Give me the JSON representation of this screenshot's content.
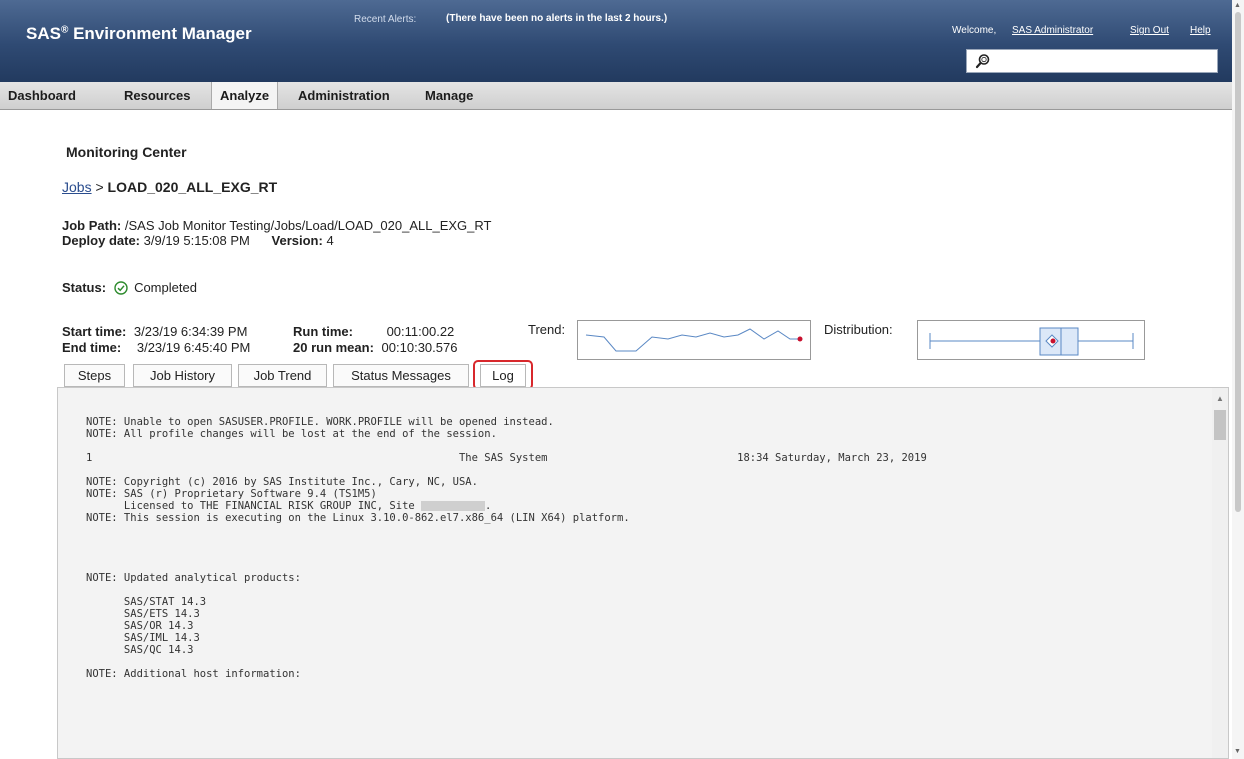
{
  "header": {
    "app_title": "SAS",
    "app_title_suffix": "Environment Manager",
    "registered": "®",
    "recent_alerts_label": "Recent Alerts:",
    "alerts_text": "(There have been no alerts in the last 2 hours.)",
    "welcome": "Welcome,",
    "user_link": "SAS Administrator",
    "sign_out": "Sign Out",
    "help": "Help",
    "search_placeholder": ""
  },
  "nav": {
    "items": [
      {
        "label": "Dashboard"
      },
      {
        "label": "Resources"
      },
      {
        "label": "Analyze"
      },
      {
        "label": "Administration"
      },
      {
        "label": "Manage"
      }
    ],
    "active": "Analyze"
  },
  "page": {
    "title": "Monitoring Center",
    "breadcrumb_link": "Jobs",
    "breadcrumb_sep": " > ",
    "breadcrumb_current": "LOAD_020_ALL_EXG_RT"
  },
  "job": {
    "path_label": "Job Path:",
    "path": "/SAS Job Monitor Testing/Jobs/Load/LOAD_020_ALL_EXG_RT",
    "deploy_label": "Deploy date:",
    "deploy_date": "3/9/19 5:15:08 PM",
    "version_label": "Version:",
    "version": "4",
    "status_label": "Status:",
    "status": "Completed",
    "start_label": "Start time:",
    "start_time": "3/23/19 6:34:39 PM",
    "end_label": "End time:",
    "end_time": "3/23/19 6:45:40 PM",
    "runtime_label": "Run time:",
    "runtime": "00:11:00.22",
    "mean_label": "20 run mean:",
    "mean": "00:10:30.576",
    "trend_label": "Trend:",
    "distribution_label": "Distribution:"
  },
  "tabs": [
    {
      "label": "Steps"
    },
    {
      "label": "Job History"
    },
    {
      "label": "Job Trend"
    },
    {
      "label": "Status Messages"
    },
    {
      "label": "Log"
    }
  ],
  "active_tab": "Log",
  "log_lines": [
    "NOTE: Unable to open SASUSER.PROFILE. WORK.PROFILE will be opened instead.",
    "NOTE: All profile changes will be lost at the end of the session.",
    "",
    "1                                                          The SAS System                              18:34 Saturday, March 23, 2019",
    "",
    "NOTE: Copyright (c) 2016 by SAS Institute Inc., Cary, NC, USA.",
    "NOTE: SAS (r) Proprietary Software 9.4 (TS1M5)",
    "      Licensed to THE FINANCIAL RISK GROUP INC, Site [REDACTED].",
    "NOTE: This session is executing on the Linux 3.10.0-862.el7.x86_64 (LIN X64) platform.",
    "",
    "",
    "",
    "",
    "NOTE: Updated analytical products:",
    "",
    "      SAS/STAT 14.3",
    "      SAS/ETS 14.3",
    "      SAS/OR 14.3",
    "      SAS/IML 14.3",
    "      SAS/QC 14.3",
    "",
    "NOTE: Additional host information:"
  ],
  "colors": {
    "header_bg": "#2f4a73",
    "highlight_red": "#d8282c",
    "status_green": "#2e8b2e",
    "link_blue": "#2a4d8e"
  },
  "icons": {
    "search": "search-icon",
    "status": "check-circle-icon"
  }
}
